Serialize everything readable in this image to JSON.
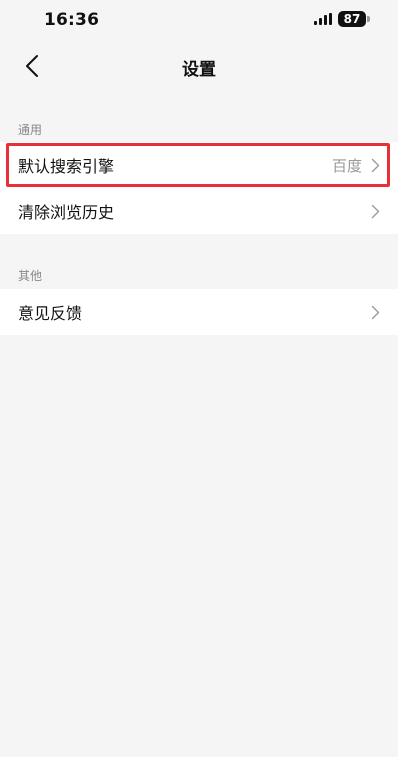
{
  "status_bar": {
    "time": "16:36",
    "battery": "87"
  },
  "nav": {
    "title": "设置",
    "back_icon": "chevron-left-icon"
  },
  "sections": [
    {
      "header": "通用",
      "items": [
        {
          "label": "默认搜索引擎",
          "value": "百度"
        },
        {
          "label": "清除浏览历史",
          "value": ""
        }
      ]
    },
    {
      "header": "其他",
      "items": [
        {
          "label": "意见反馈",
          "value": ""
        }
      ]
    }
  ],
  "colors": {
    "background": "#f5f5f5",
    "highlight": "#e8303a",
    "secondary_text": "#999999"
  }
}
